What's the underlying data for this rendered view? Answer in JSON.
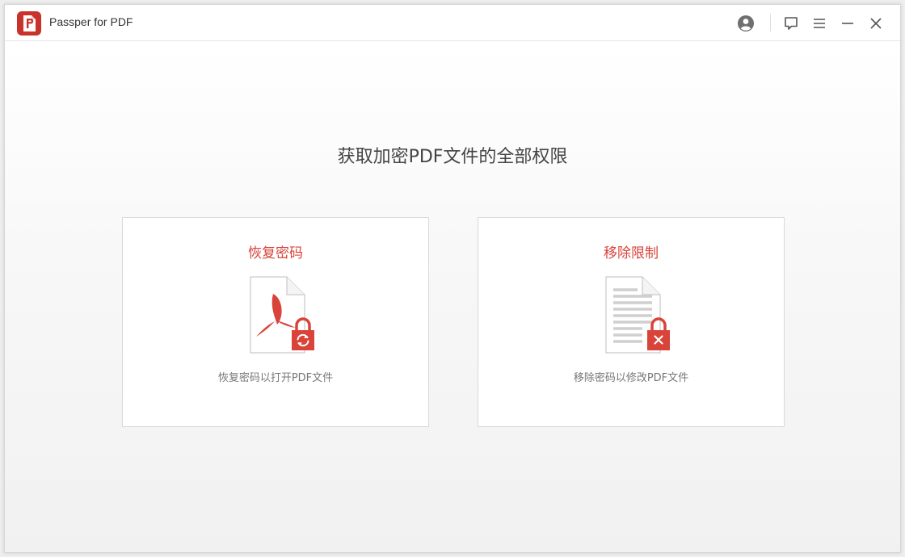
{
  "app": {
    "title": "Passper for PDF"
  },
  "titlebar": {
    "icons": [
      "account-icon",
      "feedback-icon",
      "menu-icon",
      "minimize-icon",
      "close-icon"
    ]
  },
  "main": {
    "headline": "获取加密PDF文件的全部权限",
    "cards": [
      {
        "title": "恢复密码",
        "description": "恢复密码以打开PDF文件",
        "icon": "pdf-lock-refresh-icon"
      },
      {
        "title": "移除限制",
        "description": "移除密码以修改PDF文件",
        "icon": "document-lock-remove-icon"
      }
    ]
  },
  "colors": {
    "accent": "#d9433a",
    "text": "#444444",
    "muted": "#777777",
    "border": "#d9d9d9"
  }
}
